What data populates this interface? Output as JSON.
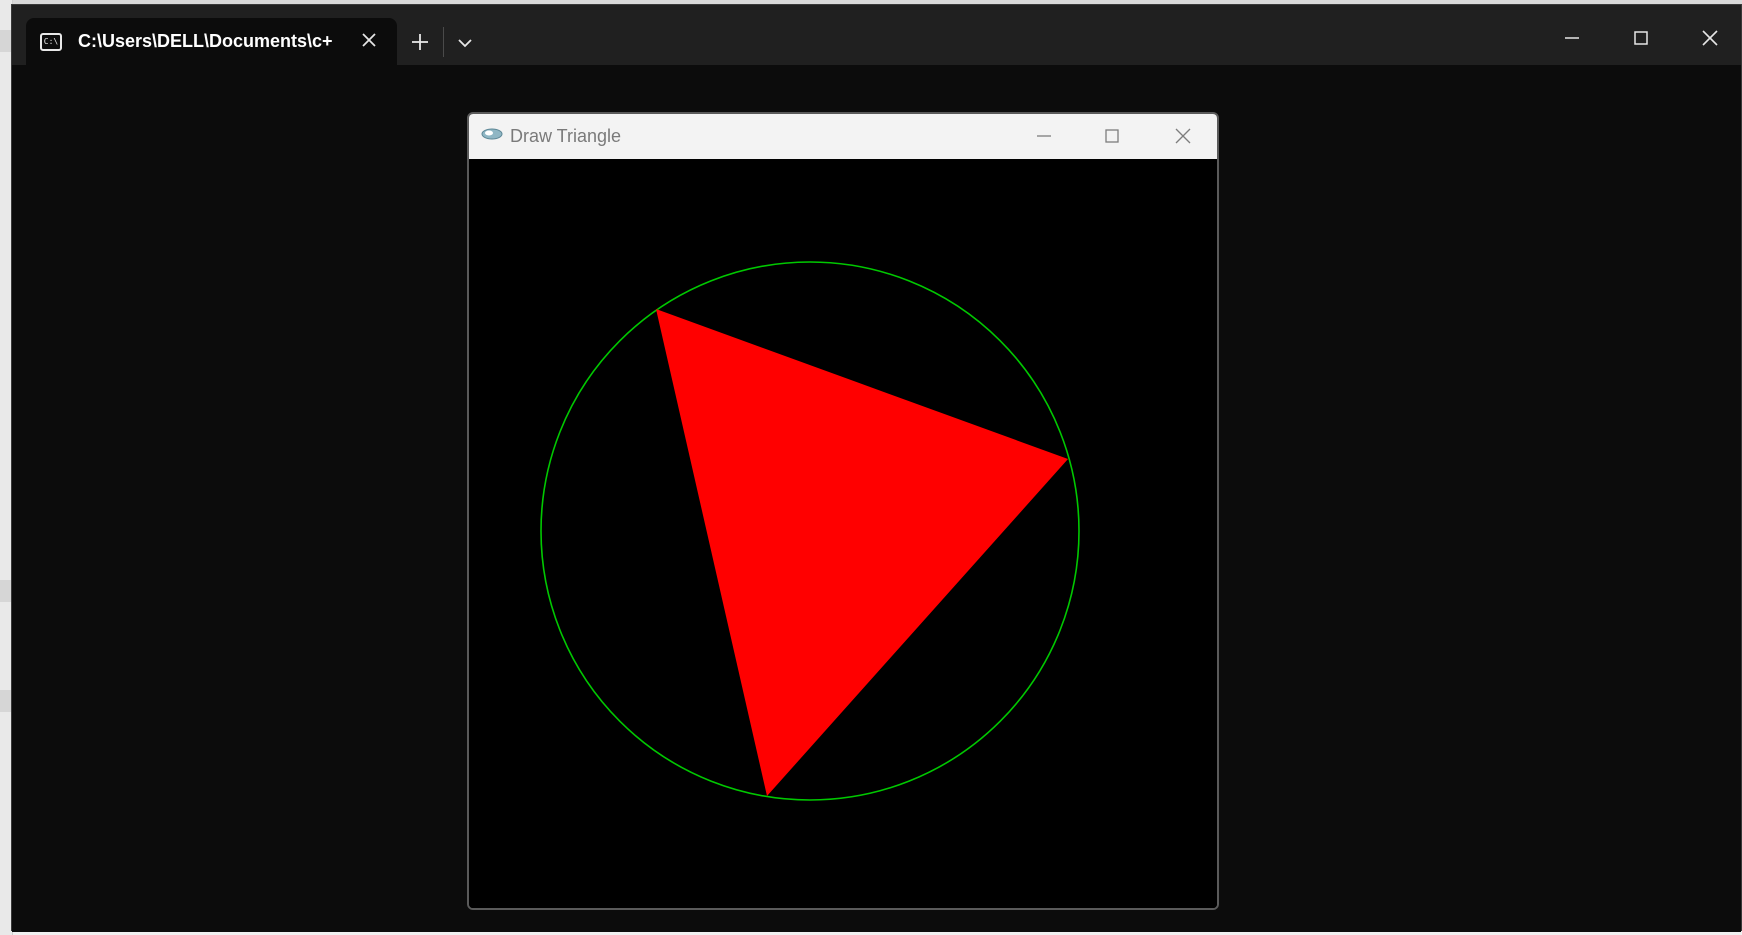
{
  "terminal": {
    "tab_title": "C:\\Users\\DELL\\Documents\\c+",
    "tab_icon": "terminal-icon",
    "tab_icon_glyph": "C:\\",
    "controls": {
      "minimize": "minimize-icon",
      "maximize": "maximize-icon",
      "close": "close-icon"
    }
  },
  "graphics_window": {
    "title": "Draw Triangle",
    "app_icon": "graphics-app-icon",
    "canvas": {
      "background": "#000000",
      "circle_color": "#00c800",
      "triangle_color": "#ff0000"
    }
  },
  "colors": {
    "terminal_bg": "#0c0c0c",
    "terminal_titlebar": "#202020",
    "window_titlebar": "#f3f3f3"
  }
}
